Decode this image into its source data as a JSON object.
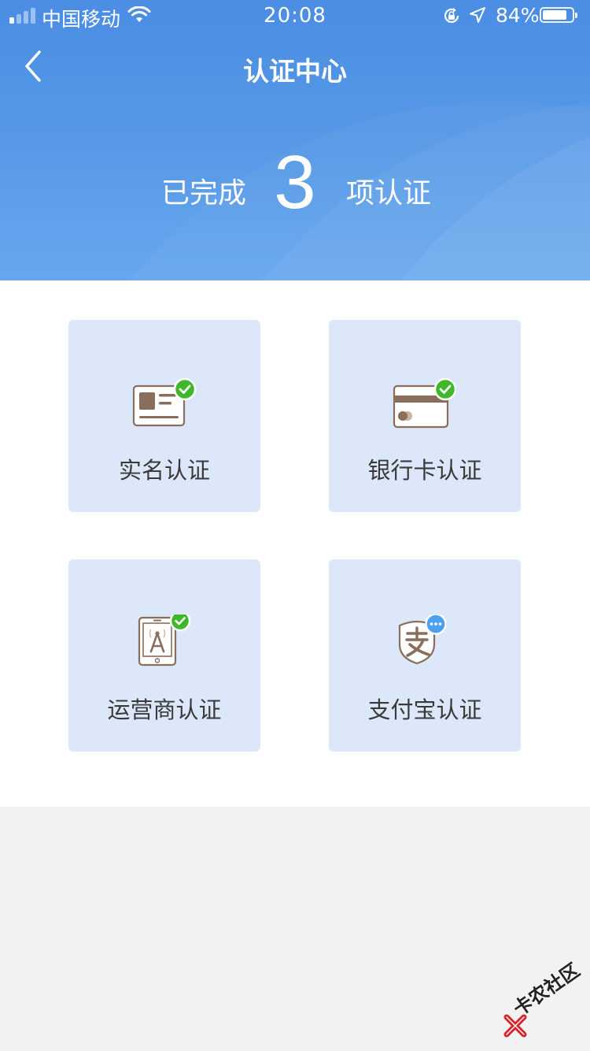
{
  "status_bar": {
    "carrier": "中国移动",
    "time": "20:08",
    "battery_percent": "84%",
    "battery_level": 0.84,
    "signal_bars_active": 1,
    "signal_bars_total": 4
  },
  "nav": {
    "title": "认证中心",
    "back_icon": "chevron-left-icon"
  },
  "summary": {
    "prefix": "已完成",
    "count": "3",
    "suffix": "项认证"
  },
  "cards": [
    {
      "label": "实名认证",
      "icon": "id-card-icon",
      "status": "verified"
    },
    {
      "label": "银行卡认证",
      "icon": "bank-card-icon",
      "status": "verified"
    },
    {
      "label": "运营商认证",
      "icon": "carrier-phone-icon",
      "status": "verified"
    },
    {
      "label": "支付宝认证",
      "icon": "alipay-icon",
      "status": "pending"
    }
  ],
  "watermark": {
    "text": "卡农社区"
  },
  "colors": {
    "header_blue": "#4a8de3",
    "card_bg": "#dce8f9",
    "icon_brown": "#8b6d5c",
    "check_green": "#3fb728",
    "pending_blue": "#4a9ff0",
    "footer_gray": "#f2f2f2"
  }
}
